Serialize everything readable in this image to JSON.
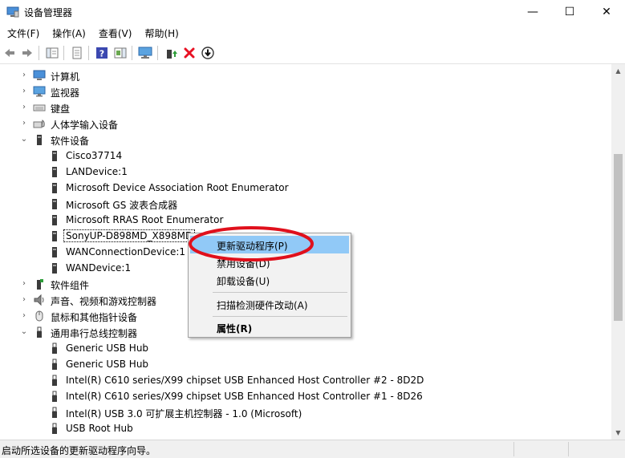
{
  "window": {
    "title": "设备管理器",
    "minimize_glyph": "—",
    "maximize_glyph": "☐",
    "close_glyph": "✕"
  },
  "menu": [
    "文件(F)",
    "操作(A)",
    "查看(V)",
    "帮助(H)"
  ],
  "toolbar": {
    "buttons": [
      "back-arrow-icon",
      "forward-arrow-icon",
      "properties-sheet-icon",
      "page-icon",
      "help-icon",
      "action-pane-icon",
      "monitor-icon",
      "update-driver-icon",
      "uninstall-x-icon",
      "download-arrow-icon"
    ],
    "uninstall_color": "#e81123",
    "help_color": "#3b48b0"
  },
  "tree": {
    "rows": [
      {
        "label": "计算机",
        "expander": "›",
        "icon": "computer-icon",
        "level": 1
      },
      {
        "label": "监视器",
        "expander": "›",
        "icon": "monitor-icon",
        "level": 1
      },
      {
        "label": "键盘",
        "expander": "›",
        "icon": "keyboard-icon",
        "level": 1
      },
      {
        "label": "人体学输入设备",
        "expander": "›",
        "icon": "hid-icon",
        "level": 1
      },
      {
        "label": "软件设备",
        "expander": "⌄",
        "icon": "software-device-icon",
        "level": 1
      },
      {
        "label": "Cisco37714",
        "expander": "",
        "icon": "software-device-icon",
        "level": 2
      },
      {
        "label": "LANDevice:1",
        "expander": "",
        "icon": "software-device-icon",
        "level": 2
      },
      {
        "label": "Microsoft Device Association Root Enumerator",
        "expander": "",
        "icon": "software-device-icon",
        "level": 2
      },
      {
        "label": "Microsoft GS 波表合成器",
        "expander": "",
        "icon": "software-device-icon",
        "level": 2
      },
      {
        "label": "Microsoft RRAS Root Enumerator",
        "expander": "",
        "icon": "software-device-icon",
        "level": 2
      },
      {
        "label": "SonyUP-D898MD_X898MD",
        "expander": "",
        "icon": "software-device-icon",
        "level": 2,
        "selected": true
      },
      {
        "label": "WANConnectionDevice:1",
        "expander": "",
        "icon": "software-device-icon",
        "level": 2
      },
      {
        "label": "WANDevice:1",
        "expander": "",
        "icon": "software-device-icon",
        "level": 2
      },
      {
        "label": "软件组件",
        "expander": "›",
        "icon": "software-component-icon",
        "level": 1
      },
      {
        "label": "声音、视频和游戏控制器",
        "expander": "›",
        "icon": "speaker-icon",
        "level": 1
      },
      {
        "label": "鼠标和其他指针设备",
        "expander": "›",
        "icon": "mouse-icon",
        "level": 1
      },
      {
        "label": "通用串行总线控制器",
        "expander": "⌄",
        "icon": "usb-icon",
        "level": 1
      },
      {
        "label": "Generic USB Hub",
        "expander": "",
        "icon": "usb-icon",
        "level": 2
      },
      {
        "label": "Generic USB Hub",
        "expander": "",
        "icon": "usb-icon",
        "level": 2
      },
      {
        "label": "Intel(R) C610 series/X99 chipset USB Enhanced Host Controller #2 - 8D2D",
        "expander": "",
        "icon": "usb-icon",
        "level": 2
      },
      {
        "label": "Intel(R) C610 series/X99 chipset USB Enhanced Host Controller #1 - 8D26",
        "expander": "",
        "icon": "usb-icon",
        "level": 2
      },
      {
        "label": "Intel(R) USB 3.0 可扩展主机控制器 - 1.0 (Microsoft)",
        "expander": "",
        "icon": "usb-icon",
        "level": 2
      },
      {
        "label": "USB Root Hub",
        "expander": "",
        "icon": "usb-icon",
        "level": 2
      }
    ]
  },
  "context_menu": {
    "items": [
      {
        "label": "更新驱动程序(P)",
        "highlighted": true
      },
      {
        "label": "禁用设备(D)"
      },
      {
        "label": "卸载设备(U)"
      },
      {
        "label": "扫描检测硬件改动(A)"
      },
      {
        "label": "属性(R)",
        "bold": true
      }
    ],
    "highlight_color": "#91c9f7",
    "annotation_color": "#e0101c"
  },
  "status": {
    "text": "启动所选设备的更新驱动程序向导。"
  }
}
